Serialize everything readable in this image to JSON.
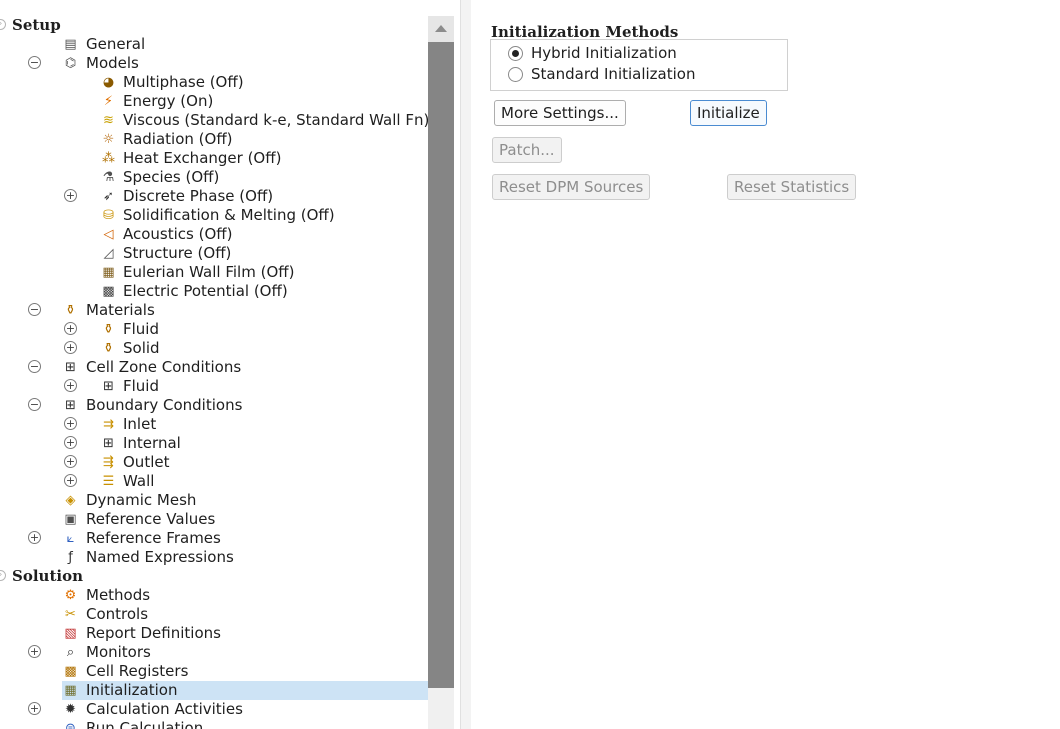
{
  "tree": {
    "items": [
      {
        "label": "Setup",
        "level": 0,
        "exp": "section",
        "bold": true,
        "icon": ""
      },
      {
        "label": "General",
        "level": 1,
        "exp": "none",
        "icon": "general-icon",
        "glyph": "▤",
        "color": "#505050"
      },
      {
        "label": "Models",
        "level": 1,
        "exp": "minus",
        "icon": "models-icon",
        "glyph": "⌬",
        "color": "#505050"
      },
      {
        "label": "Multiphase (Off)",
        "level": 2,
        "exp": "none",
        "icon": "multiphase-icon",
        "glyph": "◕",
        "color": "#8a5a00"
      },
      {
        "label": "Energy (On)",
        "level": 2,
        "exp": "none",
        "icon": "energy-icon",
        "glyph": "⚡",
        "color": "#e07000"
      },
      {
        "label": "Viscous (Standard k-e, Standard Wall Fn)",
        "level": 2,
        "exp": "none",
        "icon": "viscous-icon",
        "glyph": "≋",
        "color": "#c8a000"
      },
      {
        "label": "Radiation (Off)",
        "level": 2,
        "exp": "none",
        "icon": "radiation-icon",
        "glyph": "☼",
        "color": "#b06000"
      },
      {
        "label": "Heat Exchanger (Off)",
        "level": 2,
        "exp": "none",
        "icon": "heat-exchanger-icon",
        "glyph": "⁂",
        "color": "#b07000"
      },
      {
        "label": "Species (Off)",
        "level": 2,
        "exp": "none",
        "icon": "species-icon",
        "glyph": "⚗",
        "color": "#505050"
      },
      {
        "label": "Discrete Phase (Off)",
        "level": 2,
        "exp": "plus",
        "icon": "discrete-phase-icon",
        "glyph": "➶",
        "color": "#303030"
      },
      {
        "label": "Solidification & Melting (Off)",
        "level": 2,
        "exp": "none",
        "icon": "solidification-icon",
        "glyph": "⛁",
        "color": "#c89000"
      },
      {
        "label": "Acoustics (Off)",
        "level": 2,
        "exp": "none",
        "icon": "acoustics-icon",
        "glyph": "◁",
        "color": "#d06000"
      },
      {
        "label": "Structure (Off)",
        "level": 2,
        "exp": "none",
        "icon": "structure-icon",
        "glyph": "◿",
        "color": "#505050"
      },
      {
        "label": "Eulerian Wall Film (Off)",
        "level": 2,
        "exp": "none",
        "icon": "wall-film-icon",
        "glyph": "▦",
        "color": "#806020"
      },
      {
        "label": "Electric Potential (Off)",
        "level": 2,
        "exp": "none",
        "icon": "electric-potential-icon",
        "glyph": "▩",
        "color": "#404040"
      },
      {
        "label": "Materials",
        "level": 1,
        "exp": "minus",
        "icon": "materials-icon",
        "glyph": "⚱",
        "color": "#b07000"
      },
      {
        "label": "Fluid",
        "level": 2,
        "exp": "plus",
        "icon": "fluid-material-icon",
        "glyph": "⚱",
        "color": "#b07000"
      },
      {
        "label": "Solid",
        "level": 2,
        "exp": "plus",
        "icon": "solid-material-icon",
        "glyph": "⚱",
        "color": "#b07000"
      },
      {
        "label": "Cell Zone Conditions",
        "level": 1,
        "exp": "minus",
        "icon": "cell-zone-icon",
        "glyph": "⊞",
        "color": "#303030"
      },
      {
        "label": "Fluid",
        "level": 2,
        "exp": "plus",
        "icon": "fluid-zone-icon",
        "glyph": "⊞",
        "color": "#303030"
      },
      {
        "label": "Boundary Conditions",
        "level": 1,
        "exp": "minus",
        "icon": "boundary-conditions-icon",
        "glyph": "⊞",
        "color": "#303030"
      },
      {
        "label": "Inlet",
        "level": 2,
        "exp": "plus",
        "icon": "inlet-icon",
        "glyph": "⇉",
        "color": "#c89000"
      },
      {
        "label": "Internal",
        "level": 2,
        "exp": "plus",
        "icon": "internal-icon",
        "glyph": "⊞",
        "color": "#303030"
      },
      {
        "label": "Outlet",
        "level": 2,
        "exp": "plus",
        "icon": "outlet-icon",
        "glyph": "⇶",
        "color": "#c89000"
      },
      {
        "label": "Wall",
        "level": 2,
        "exp": "plus",
        "icon": "wall-icon",
        "glyph": "☰",
        "color": "#c89000"
      },
      {
        "label": "Dynamic Mesh",
        "level": 1,
        "exp": "none",
        "icon": "dynamic-mesh-icon",
        "glyph": "◈",
        "color": "#c89000"
      },
      {
        "label": "Reference Values",
        "level": 1,
        "exp": "none",
        "icon": "reference-values-icon",
        "glyph": "▣",
        "color": "#505050"
      },
      {
        "label": "Reference Frames",
        "level": 1,
        "exp": "plus",
        "icon": "reference-frames-icon",
        "glyph": "⟀",
        "color": "#3060c0"
      },
      {
        "label": "Named Expressions",
        "level": 1,
        "exp": "none",
        "icon": "named-expressions-icon",
        "glyph": "ƒ",
        "color": "#303030"
      },
      {
        "label": "Solution",
        "level": 0,
        "exp": "section",
        "bold": true,
        "icon": ""
      },
      {
        "label": "Methods",
        "level": 1,
        "exp": "none",
        "icon": "methods-icon",
        "glyph": "⚙",
        "color": "#e07000"
      },
      {
        "label": "Controls",
        "level": 1,
        "exp": "none",
        "icon": "controls-icon",
        "glyph": "✂",
        "color": "#c89000"
      },
      {
        "label": "Report Definitions",
        "level": 1,
        "exp": "none",
        "icon": "report-definitions-icon",
        "glyph": "▧",
        "color": "#c03030"
      },
      {
        "label": "Monitors",
        "level": 1,
        "exp": "plus",
        "icon": "monitors-icon",
        "glyph": "⌕",
        "color": "#303030"
      },
      {
        "label": "Cell Registers",
        "level": 1,
        "exp": "none",
        "icon": "cell-registers-icon",
        "glyph": "▩",
        "color": "#b07000"
      },
      {
        "label": "Initialization",
        "level": 1,
        "exp": "none",
        "icon": "initialization-icon",
        "glyph": "▦",
        "color": "#707030",
        "selected": true
      },
      {
        "label": "Calculation Activities",
        "level": 1,
        "exp": "plus",
        "icon": "calculation-activities-icon",
        "glyph": "✹",
        "color": "#303030"
      },
      {
        "label": "Run Calculation",
        "level": 1,
        "exp": "none",
        "icon": "run-calculation-icon",
        "glyph": "⊜",
        "color": "#3060c0"
      }
    ]
  },
  "init": {
    "title": "Initialization Methods",
    "hybrid_label": "Hybrid  Initialization",
    "standard_label": "Standard Initialization",
    "selected_method": "Hybrid  Initialization"
  },
  "buttons": {
    "more_settings": "More Settings...",
    "initialize": "Initialize",
    "patch": "Patch...",
    "reset_dpm": "Reset DPM Sources",
    "reset_statistics": "Reset Statistics"
  }
}
